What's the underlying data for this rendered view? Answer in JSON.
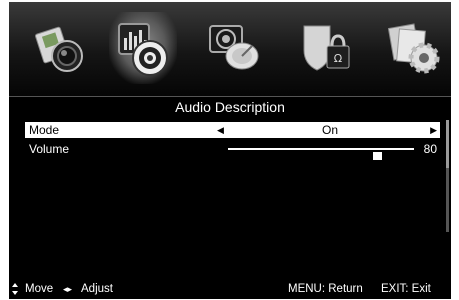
{
  "tabs": [
    {
      "name": "picture",
      "icon": "picture-icon",
      "active": false
    },
    {
      "name": "sound",
      "icon": "sound-icon",
      "active": true
    },
    {
      "name": "channel",
      "icon": "channel-icon",
      "active": false
    },
    {
      "name": "lock",
      "icon": "lock-icon",
      "active": false
    },
    {
      "name": "setup",
      "icon": "setup-icon",
      "active": false
    }
  ],
  "page": {
    "title": "Audio Description"
  },
  "items": {
    "mode": {
      "label": "Mode",
      "value": "On",
      "left_arrow": "◀",
      "right_arrow": "▶"
    },
    "volume": {
      "label": "Volume",
      "value": "80",
      "level": 80
    }
  },
  "footer": {
    "move_label": "Move",
    "adjust_label": "Adjust",
    "adjust_arrows": "◂▸",
    "menu_return": "MENU: Return",
    "exit": "EXIT: Exit"
  },
  "colors": {
    "background": "#000000",
    "selected_row": "#ffffff",
    "text": "#ffffff"
  }
}
